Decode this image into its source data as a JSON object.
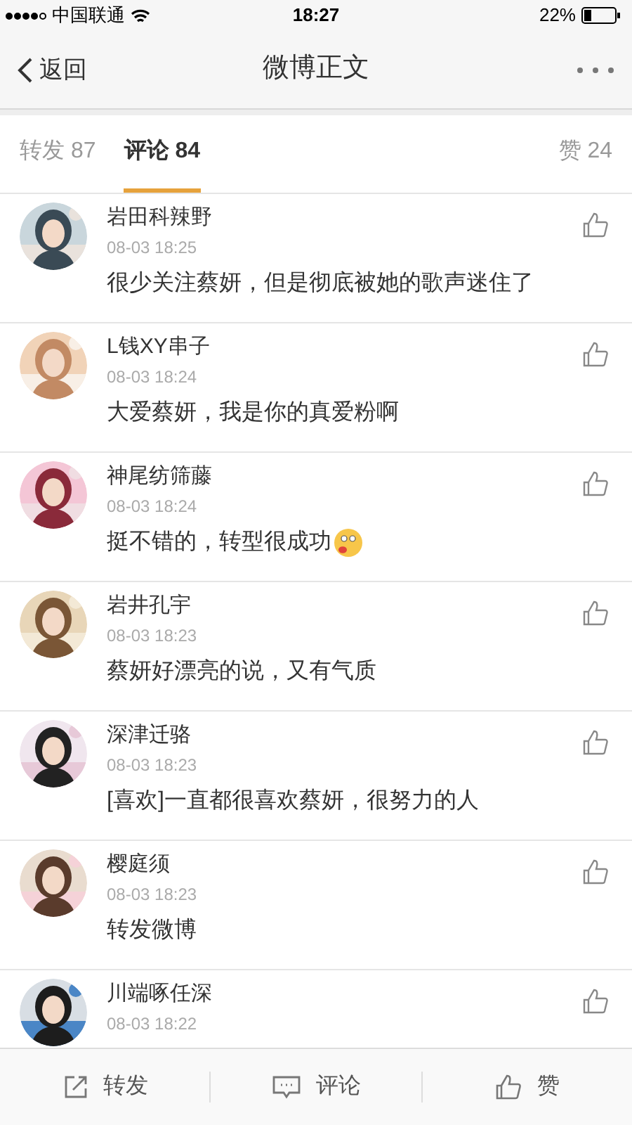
{
  "status_bar": {
    "carrier": "中国联通",
    "time": "18:27",
    "battery": "22%"
  },
  "nav": {
    "back": "返回",
    "title": "微博正文"
  },
  "tabs": [
    {
      "label": "转发 87",
      "selected": false
    },
    {
      "label": "评论 84",
      "selected": true
    },
    {
      "label": "赞 24",
      "selected": false
    }
  ],
  "comments": [
    {
      "name": "岩田科辣野",
      "time": "08-03 18:25",
      "text": "很少关注蔡妍，但是彻底被她的歌声迷住了",
      "emoji": false
    },
    {
      "name": "L钱XY串子",
      "time": "08-03 18:24",
      "text": "大爱蔡妍，我是你的真爱粉啊",
      "emoji": false
    },
    {
      "name": "神尾纺筛藤",
      "time": "08-03 18:24",
      "text": "挺不错的，转型很成功",
      "emoji": true
    },
    {
      "name": "岩井孔宇",
      "time": "08-03 18:23",
      "text": "蔡妍好漂亮的说，又有气质",
      "emoji": false
    },
    {
      "name": "深津迁骆",
      "time": "08-03 18:23",
      "text": "[喜欢]一直都很喜欢蔡妍，很努力的人",
      "emoji": false
    },
    {
      "name": "樱庭须",
      "time": "08-03 18:23",
      "text": "转发微博",
      "emoji": false
    },
    {
      "name": "川端啄任深",
      "time": "08-03 18:22"
    }
  ],
  "toolbar": [
    {
      "kind": "repost",
      "label": "转发"
    },
    {
      "kind": "comment",
      "label": "评论"
    },
    {
      "kind": "like",
      "label": "赞"
    }
  ]
}
